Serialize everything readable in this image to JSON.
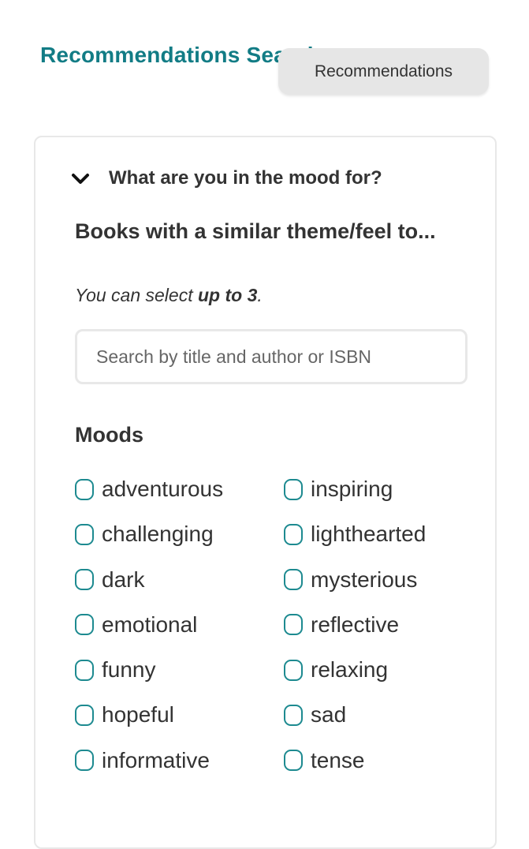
{
  "header": {
    "title": "Recommendations Search",
    "recommendations_button": "Recommendations"
  },
  "accordion": {
    "title": "What are you in the mood for?",
    "expanded": true
  },
  "similar_books": {
    "title": "Books with a similar theme/feel to...",
    "hint_prefix": "You can select ",
    "hint_bold": "up to 3",
    "hint_suffix": ".",
    "search": {
      "placeholder": "Search by title and author or ISBN",
      "value": ""
    }
  },
  "moods": {
    "title": "Moods",
    "items": [
      {
        "label": "adventurous",
        "checked": false
      },
      {
        "label": "inspiring",
        "checked": false
      },
      {
        "label": "challenging",
        "checked": false
      },
      {
        "label": "lighthearted",
        "checked": false
      },
      {
        "label": "dark",
        "checked": false
      },
      {
        "label": "mysterious",
        "checked": false
      },
      {
        "label": "emotional",
        "checked": false
      },
      {
        "label": "reflective",
        "checked": false
      },
      {
        "label": "funny",
        "checked": false
      },
      {
        "label": "relaxing",
        "checked": false
      },
      {
        "label": "hopeful",
        "checked": false
      },
      {
        "label": "sad",
        "checked": false
      },
      {
        "label": "informative",
        "checked": false
      },
      {
        "label": "tense",
        "checked": false
      }
    ]
  },
  "colors": {
    "accent": "#127c85",
    "checkbox_border": "#1d8a90",
    "button_bg": "#e6e6e6",
    "text": "#333333"
  }
}
